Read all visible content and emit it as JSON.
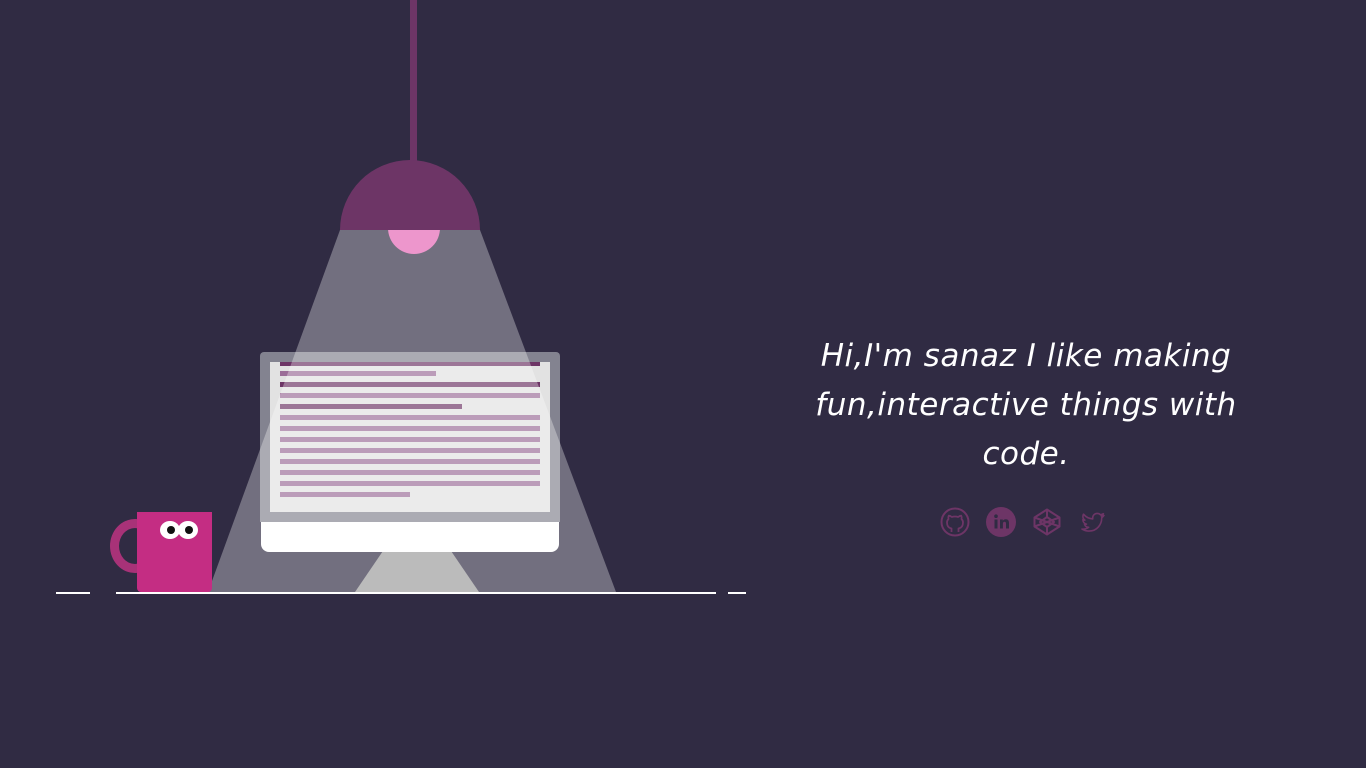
{
  "intro": {
    "text": "Hi,I'm sanaz I like making fun,interactive things with code."
  },
  "social": [
    {
      "name": "github",
      "icon": "github-icon"
    },
    {
      "name": "linkedin",
      "icon": "linkedin-icon"
    },
    {
      "name": "codepen",
      "icon": "codepen-icon"
    },
    {
      "name": "twitter",
      "icon": "twitter-icon"
    }
  ],
  "colors": {
    "background": "#302b43",
    "accent": "#6d3566",
    "bulb": "#e565b4",
    "mug": "#c42d83",
    "code": "#9b6d98"
  }
}
